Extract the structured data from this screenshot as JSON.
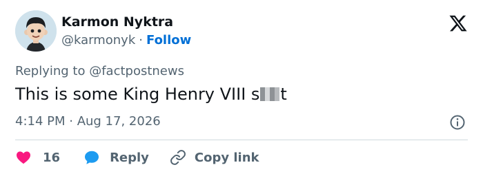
{
  "author": {
    "name": "Karmon Nyktra",
    "handle": "@karmonyk",
    "separator": "·",
    "follow_label": "Follow"
  },
  "tweet": {
    "replying_to": "Replying to @factpostnews",
    "text_before": "This is some King Henry VIII s",
    "text_after": "t",
    "timestamp": "4:14 PM · Aug 17, 2026"
  },
  "actions": {
    "like_count": "16",
    "reply_label": "Reply",
    "copy_link_label": "Copy link"
  },
  "icons": {
    "logo": "x-logo-icon",
    "info": "info-icon",
    "like": "heart-icon",
    "reply": "speech-bubble-icon",
    "copy": "link-icon"
  },
  "colors": {
    "text": "#0f1419",
    "muted": "#536471",
    "follow": "#006fd6",
    "like": "#f91880",
    "reply": "#1d9bf0",
    "divider": "#cfd9de"
  }
}
